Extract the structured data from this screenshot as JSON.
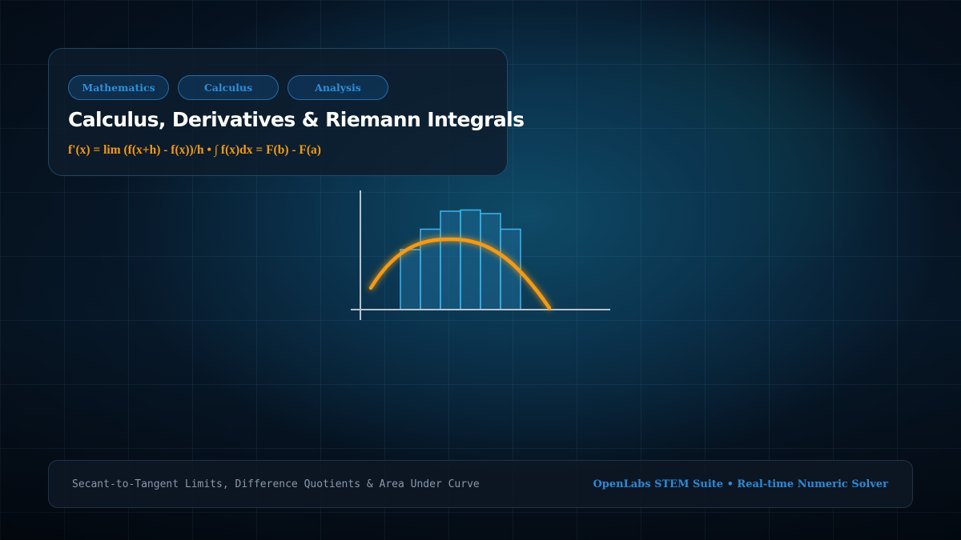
{
  "header": {
    "tags": [
      "Mathematics",
      "Calculus",
      "Analysis"
    ],
    "title": "Calculus, Derivatives & Riemann Integrals",
    "formula": "f'(x) = lim (f(x+h) - f(x))/h • ∫ f(x)dx = F(b) - F(a)"
  },
  "diagram": {
    "riemann_bar_heights": [
      0.5,
      0.67,
      0.82,
      0.83,
      0.8,
      0.67
    ],
    "colors": {
      "curve": "#f59a12",
      "bar_fill": "#1d6a96",
      "bar_stroke": "#3fb5ef",
      "axis": "#b9c3cc"
    }
  },
  "footer": {
    "left_text": "Secant-to-Tangent Limits, Difference Quotients & Area Under Curve",
    "right_text": "OpenLabs STEM Suite • Real-time Numeric Solver"
  }
}
